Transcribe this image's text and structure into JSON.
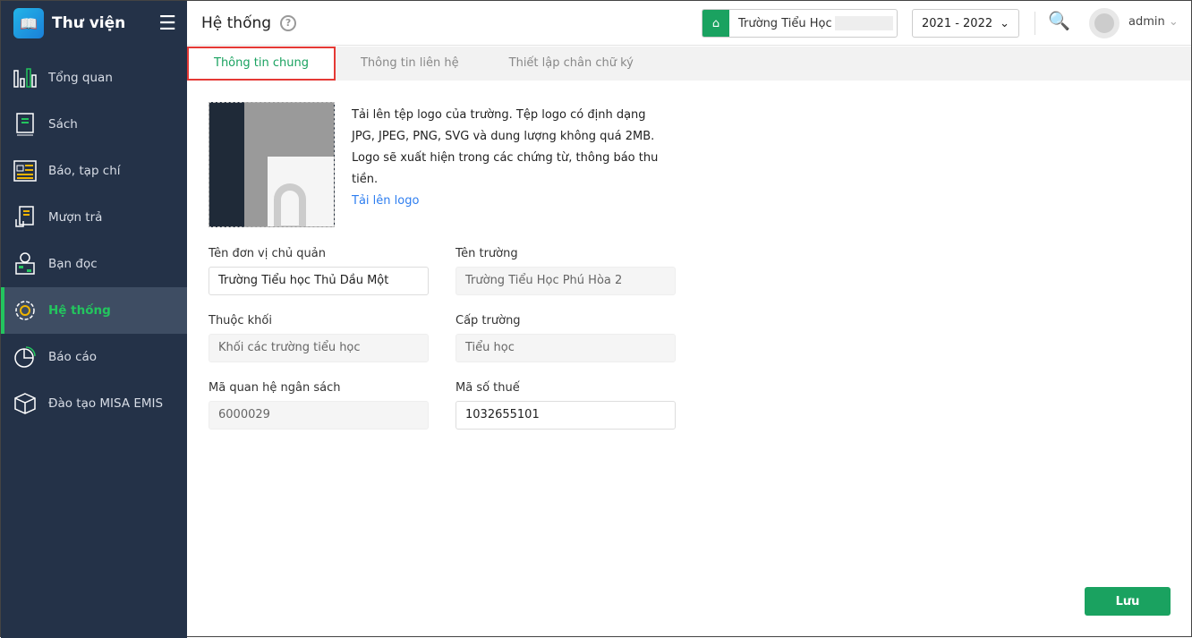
{
  "app": {
    "name": "Thư viện"
  },
  "sidebar": {
    "items": [
      {
        "label": "Tổng quan",
        "icon": "bar-chart-icon"
      },
      {
        "label": "Sách",
        "icon": "book-icon"
      },
      {
        "label": "Báo, tạp chí",
        "icon": "newspaper-icon"
      },
      {
        "label": "Mượn trả",
        "icon": "borrow-icon"
      },
      {
        "label": "Bạn đọc",
        "icon": "reader-icon"
      },
      {
        "label": "Hệ thống",
        "icon": "gear-icon",
        "active": true
      },
      {
        "label": "Báo cáo",
        "icon": "pie-chart-icon"
      },
      {
        "label": "Đào tạo MISA EMIS",
        "icon": "cube-icon"
      }
    ]
  },
  "header": {
    "title": "Hệ thống",
    "school": "Trường Tiểu Học",
    "year": "2021 - 2022",
    "user": "admin"
  },
  "tabs": [
    "Thông tin chung",
    "Thông tin liên hệ",
    "Thiết lập chân chữ ký"
  ],
  "logo": {
    "description": "Tải lên tệp logo của trường. Tệp logo có định dạng JPG, JPEG, PNG, SVG và dung lượng không quá 2MB. Logo sẽ xuất hiện trong các chứng từ, thông báo thu tiền.",
    "upload_label": "Tải lên logo"
  },
  "form": {
    "parent_unit": {
      "label": "Tên đơn vị chủ quản",
      "value": "Trường Tiểu học Thủ Dầu Một"
    },
    "school_name": {
      "label": "Tên trường",
      "value": "Trường Tiểu Học Phú Hòa 2"
    },
    "block": {
      "label": "Thuộc khối",
      "value": "Khối các trường tiểu học"
    },
    "level": {
      "label": "Cấp trường",
      "value": "Tiểu học"
    },
    "budget_code": {
      "label": "Mã quan hệ ngân sách",
      "value": "6000029"
    },
    "tax_code": {
      "label": "Mã số thuế",
      "value": "1032655101"
    }
  },
  "actions": {
    "save": "Lưu"
  },
  "colors": {
    "sidebar": "#243248",
    "accent": "#1aa260"
  }
}
